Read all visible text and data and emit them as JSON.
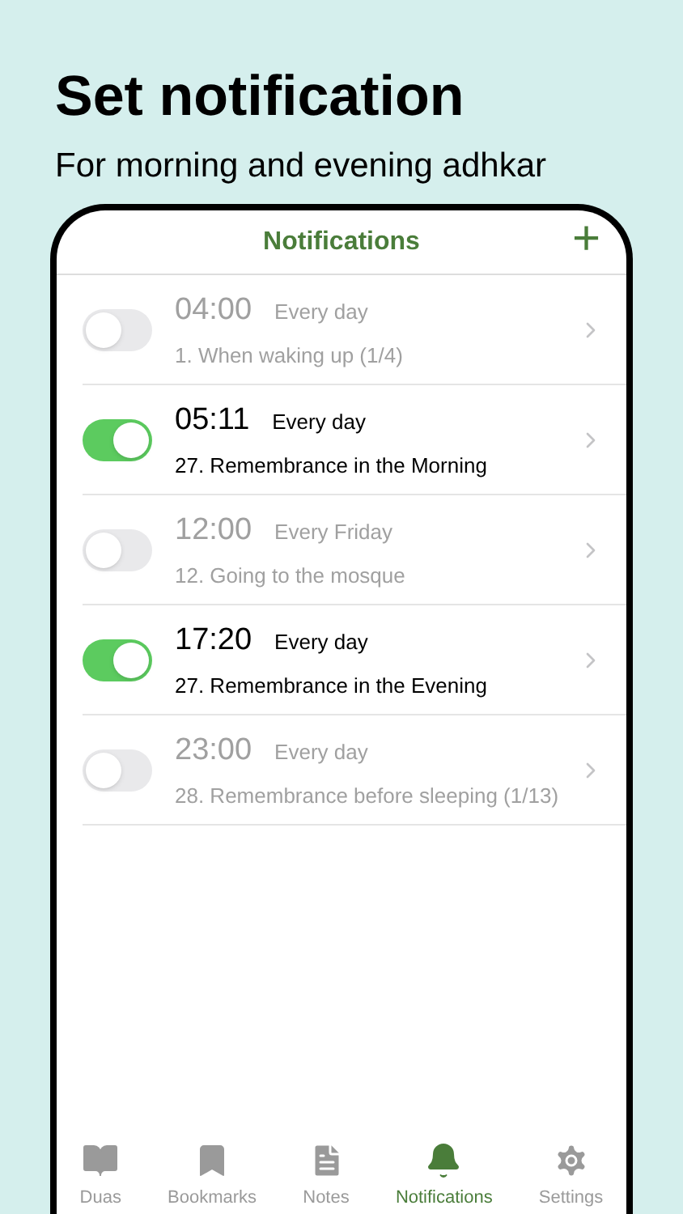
{
  "headline": "Set notification",
  "subheadline": "For morning and evening adhkar",
  "nav": {
    "title": "Notifications",
    "add": "+"
  },
  "alarms": [
    {
      "time": "04:00",
      "repeat": "Every day",
      "name": "1. When waking up (1/4)",
      "on": false
    },
    {
      "time": "05:11",
      "repeat": "Every day",
      "name": "27. Remembrance in the Morning",
      "on": true
    },
    {
      "time": "12:00",
      "repeat": "Every Friday",
      "name": "12. Going to the mosque",
      "on": false
    },
    {
      "time": "17:20",
      "repeat": "Every day",
      "name": "27. Remembrance in the Evening",
      "on": true
    },
    {
      "time": "23:00",
      "repeat": "Every day",
      "name": "28. Remembrance before sleeping (1/13)",
      "on": false
    }
  ],
  "tabs": [
    {
      "kind": "book",
      "label": "Duas",
      "selected": false
    },
    {
      "kind": "bookmark",
      "label": "Bookmarks",
      "selected": false
    },
    {
      "kind": "notes",
      "label": "Notes",
      "selected": false
    },
    {
      "kind": "bell",
      "label": "Notifications",
      "selected": true
    },
    {
      "kind": "gear",
      "label": "Settings",
      "selected": false
    }
  ]
}
